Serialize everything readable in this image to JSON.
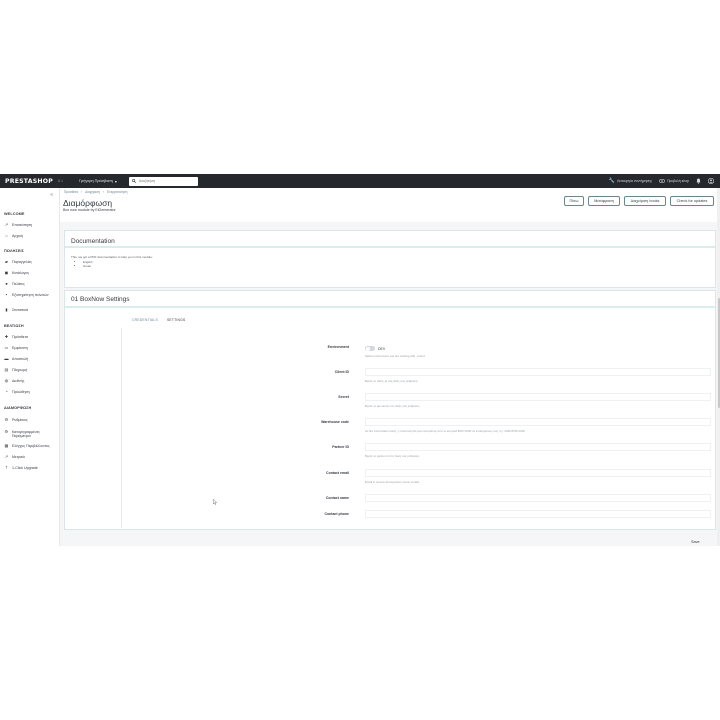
{
  "header": {
    "logo": "PRESTASHOP",
    "version": "8.1",
    "quick_access": "Γρήγορη Πρόσβαση",
    "search_placeholder": "Αναζήτηση",
    "maintenance_link": "Λειτουργία συντήρησης",
    "view_shop": "Προβολή shop"
  },
  "sidebar": {
    "sections": [
      {
        "title": "WELCOME",
        "items": [
          {
            "label": "Επισκόπηση",
            "icon": "trend-icon"
          },
          {
            "label": "Αρχική",
            "icon": "home-icon"
          }
        ]
      },
      {
        "title": "ΠΩΛΗΣΕΙΣ",
        "items": [
          {
            "label": "Παραγγελίες",
            "icon": "cart-icon"
          },
          {
            "label": "Κατάλογος",
            "icon": "tag-icon"
          },
          {
            "label": "Πελάτες",
            "icon": "user-icon"
          },
          {
            "label": "Εξυπηρέτηση πελατών",
            "icon": "chat-icon"
          },
          {
            "label": "Στατιστικά",
            "icon": "chart-icon"
          }
        ]
      },
      {
        "title": "ΒΕΛΤΙΩΣΗ",
        "items": [
          {
            "label": "Πρόσθετα",
            "icon": "puzzle-icon"
          },
          {
            "label": "Εμφάνιση",
            "icon": "monitor-icon"
          },
          {
            "label": "Αποστολή",
            "icon": "truck-icon"
          },
          {
            "label": "Πληρωμή",
            "icon": "card-icon"
          },
          {
            "label": "Διεθνής",
            "icon": "globe-icon"
          },
          {
            "label": "Προώθηση",
            "icon": "megaphone-icon"
          }
        ]
      },
      {
        "title": "ΔΙΑΜΟΡΦΩΣΗ",
        "items": [
          {
            "label": "Ρυθμίσεις",
            "icon": "gear-icon"
          },
          {
            "label": "Καταγεγραμμένες Παράμετροι",
            "icon": "settings-icon"
          },
          {
            "label": "Ελέγχος Περιβάλλοντος",
            "icon": "grid-icon"
          },
          {
            "label": "Μετρικά",
            "icon": "trend-icon"
          },
          {
            "label": "1-Click Upgrade",
            "icon": "upload-icon"
          }
        ]
      }
    ]
  },
  "breadcrumb": [
    "Πρόσθετα",
    "Διαχείριση",
    "Ενεργοποίηση"
  ],
  "page": {
    "title": "Διαμόρφωση",
    "subtitle": "Box now module by ElGemerator"
  },
  "toolbar": {
    "back": "Πίσω",
    "translate": "Μετάφραση",
    "manage_hooks": "Διαχείριση hooks",
    "check_updates": "Check for updates"
  },
  "documentation": {
    "title": "Documentation",
    "intro": "This, we got a PDF documentation to help you in this module:",
    "languages": [
      "English",
      "Greek"
    ]
  },
  "settings": {
    "title": "01 BoxNow Settings",
    "tabs": [
      "CREDENTIALS",
      "SETTINGS"
    ],
    "environment_label": "Environment",
    "environment_value": "DEV",
    "environment_help": "Select environment you are working with, or/and",
    "fields": [
      {
        "label": "Client ID",
        "help": "Βρείτε το client_id στις δικές σας ρυθμίσεις"
      },
      {
        "label": "Secret",
        "help": "Βρείτε το api secret στις δικές σας ρυθμίσεις"
      },
      {
        "label": "Warehouse code",
        "help": "Αν δεν αποστείλετε σκίνη, η αποστολή θα γίνει αυτομάτως από το κεντρικό BOX NOW σε επιλεγμένους σας π.χ. 2345,8765,2238"
      },
      {
        "label": "Partner ID",
        "help": "Βρείτε το partner id στις δικές σας ρυθμίσεις"
      },
      {
        "label": "Contact email",
        "help": "Email to receive all important courier emails"
      },
      {
        "label": "Contact name",
        "help": ""
      },
      {
        "label": "Contact phone",
        "help": ""
      }
    ],
    "save": "Save"
  }
}
